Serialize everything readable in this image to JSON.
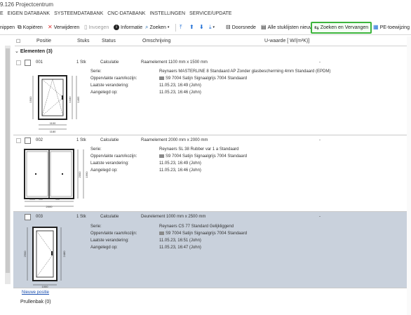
{
  "title": "9.126 Projectcentrum",
  "menu": [
    "E",
    "EIGEN DATABANK",
    "SYSTEEMDATABANK",
    "CNC-DATABANK",
    "INSTELLINGEN",
    "SERVICE/UPDATE"
  ],
  "toolbar": {
    "knippen": "nippen",
    "kopieren": "Kopiëren",
    "verwijderen": "Verwijderen",
    "invoegen": "Invoegen",
    "informatie": "Informatie",
    "zoeken": "Zoeken",
    "doorsnede": "Doorsnede",
    "stuklijsten": "Alle stuklijsten nieuw",
    "zoeken_vervangen": "Zoeken en Vervangen",
    "pe_toewijzing": "PE-toewijzing"
  },
  "columns": {
    "positie": "Positie",
    "stuks": "Stuks",
    "status": "Status",
    "omschrijving": "Omschrijving",
    "uwaarde": "U-waarde [ W/(m²K)]"
  },
  "group": "Elementen (3)",
  "labels": {
    "serie": "Serie:",
    "oppervlakte": "Oppervlakte raam/kozijn:",
    "laatste": "Laatste verandering:",
    "aangelegd": "Aangelegd op:"
  },
  "rows": [
    {
      "positie": "001",
      "stuks": "1 Stk",
      "status": "Calculatie",
      "omschrijving": "Raamelement 1100 mm x 1500 mm",
      "uwaarde": "-",
      "serie": "Reynaers MASTERLINE 8   Standaard AP Zonder glasbescherming 4mm Standaard (EPDM)",
      "oppervlakte": "S9 7004  Satijn Signaalgrijs 7004 Standaard",
      "laatste": "11.05.23, 16:49 (John)",
      "aangelegd": "11.05.23, 16:46 (John)"
    },
    {
      "positie": "002",
      "stuks": "1 Stk",
      "status": "Calculatie",
      "omschrijving": "Raamelement 2000 mm x 2000 mm",
      "uwaarde": "-",
      "serie": "Reynaers SL 38 Rubber var 1 a Standaard",
      "oppervlakte": "S9 7004  Satijn Signaalgrijs 7004 Standaard",
      "laatste": "11.05.23, 16:49 (John)",
      "aangelegd": "11.05.23, 16:46 (John)"
    },
    {
      "positie": "003",
      "stuks": "1 Stk",
      "status": "Calculatie",
      "omschrijving": "Deurelement 1000 mm x 2500 mm",
      "uwaarde": "-",
      "serie": "Reynaers CS 77   Standard Gelijkliggend",
      "oppervlakte": "S9 7004  Satijn Signaalgrijs 7004 Standaard",
      "laatste": "11.05.23, 16:51 (John)",
      "aangelegd": "11.05.23, 16:47 (John)"
    }
  ],
  "dims": {
    "r1": [
      "1100",
      "1180",
      "1500",
      "1440",
      "1495"
    ],
    "r2": [
      "2000",
      "1000",
      "900",
      "900",
      "2000",
      "1990"
    ],
    "r3": [
      "1000",
      "2500",
      "2480"
    ]
  },
  "nieuwe_positie": "Nieuwe positie",
  "prullenbak": "Prullenbak (0)",
  "colors": {
    "selected_row": "#c9d1dc",
    "highlight_border": "#3cb43c",
    "arrow_blue": "#1f6fd6"
  }
}
